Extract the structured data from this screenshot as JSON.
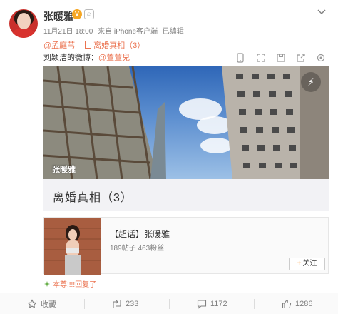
{
  "post": {
    "author": "张暖雅",
    "meta": {
      "time": "11月21日 18:00",
      "source": "来自 iPhone客户端",
      "edited": "已编辑"
    },
    "mention": "@孟庭苇",
    "article_link": "离婚真相（3）",
    "reply_prefix": "刘颖洁的微博：",
    "reply_mention": "@萱萱兒"
  },
  "media": {
    "watermark": "张暖雅",
    "article_title": "离婚真相（3）"
  },
  "supertopic_card": {
    "title": "【超话】张暖雅",
    "stats": "189帖子 463粉丝",
    "follow_label": "关注"
  },
  "liked_note": "本尊!!!!回复了",
  "actions": {
    "collect": "收藏",
    "repost": "233",
    "comment": "1172",
    "like": "1286"
  },
  "icons": {
    "badge": "verified-v-icon",
    "dropdown": "chevron-down-icon",
    "toolbar": [
      "phone-icon",
      "expand-icon",
      "save-icon",
      "share-icon",
      "settings-icon"
    ],
    "live": "lightning-icon",
    "collect": "star-icon",
    "repost": "repost-icon",
    "comment": "comment-icon",
    "like": "thumbs-up-icon"
  },
  "colors": {
    "link": "#eb7350",
    "follow_plus": "#ff8200",
    "badge": "#f5a623"
  }
}
